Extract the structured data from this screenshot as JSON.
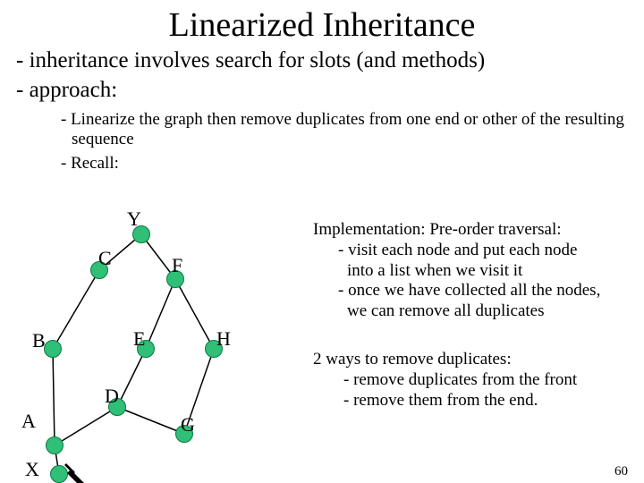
{
  "title": "Linearized Inheritance",
  "b1": "- inheritance involves search for slots (and methods)",
  "b2": "- approach:",
  "sub1": "- Linearize the graph then remove duplicates from one end or other of the resulting sequence",
  "sub2": "- Recall:",
  "nodes": {
    "Y": "Y",
    "C": "C",
    "F": "F",
    "B": "B",
    "E": "E",
    "H": "H",
    "A": "A",
    "D": "D",
    "G": "G",
    "X": "X"
  },
  "impl": {
    "head": "Implementation:  Pre-order traversal:",
    "l1": "- visit each node and put each node",
    "l1b": "into a list when we visit it",
    "l2": "- once we have collected all the nodes,",
    "l2b": "we can remove all duplicates"
  },
  "ways": {
    "head": "2 ways to remove duplicates:",
    "l1": "- remove duplicates from the front",
    "l2": "- remove them from the end."
  },
  "pagenum": "60"
}
